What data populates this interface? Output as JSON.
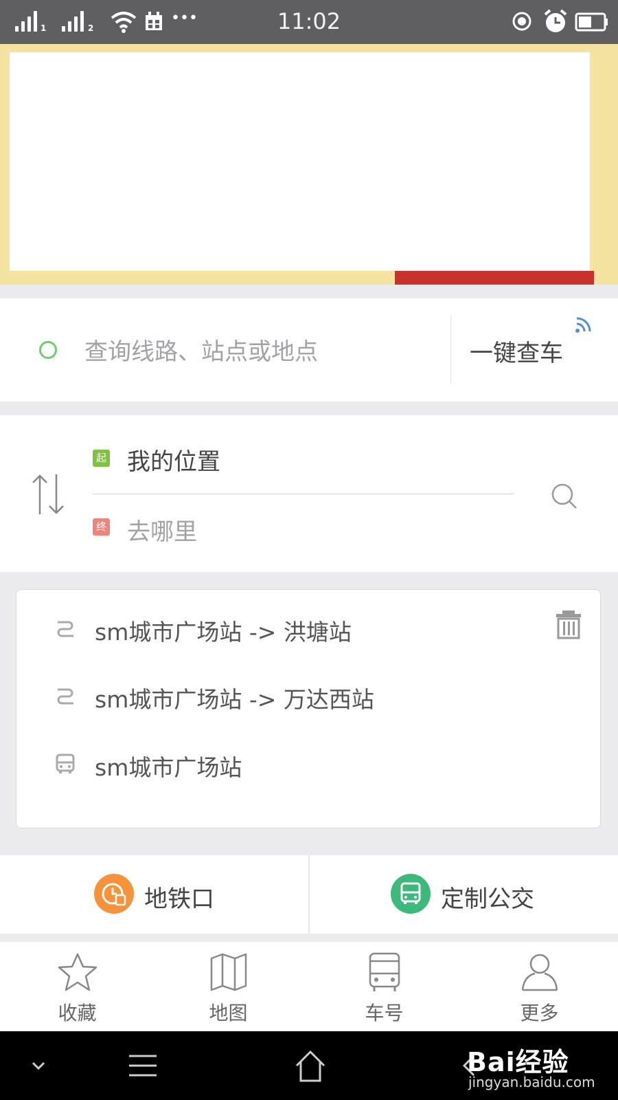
{
  "status_bar": {
    "time": "11:02",
    "sim1": "1",
    "sim2": "2",
    "more_dots": "•••"
  },
  "search": {
    "placeholder": "查询线路、站点或地点",
    "quick_check_label": "一键查车"
  },
  "route": {
    "start_tag": "起",
    "start_value": "我的位置",
    "end_tag": "终",
    "end_placeholder": "去哪里"
  },
  "history": {
    "items": [
      {
        "type": "route-icon",
        "text": "sm城市广场站 -> 洪塘站"
      },
      {
        "type": "route-icon",
        "text": "sm城市广场站 -> 万达西站"
      },
      {
        "type": "bus-icon",
        "text": "sm城市广场站"
      }
    ]
  },
  "shortcuts": [
    {
      "label": "地铁口",
      "color": "#f5923a",
      "icon": "subway-clock-icon"
    },
    {
      "label": "定制公交",
      "color": "#3dba7b",
      "icon": "bus-icon"
    }
  ],
  "tabs": [
    {
      "label": "收藏",
      "icon": "star-icon"
    },
    {
      "label": "地图",
      "icon": "map-icon"
    },
    {
      "label": "车号",
      "icon": "bus-icon"
    },
    {
      "label": "更多",
      "icon": "user-icon"
    }
  ],
  "watermark": {
    "brand": "Bai经验",
    "url": "jingyan.baidu.com"
  },
  "colors": {
    "accent_green": "#6dcf6b",
    "start_tag": "#80c042",
    "end_tag": "#f0847b",
    "banner_bg": "#f5e3a2"
  }
}
